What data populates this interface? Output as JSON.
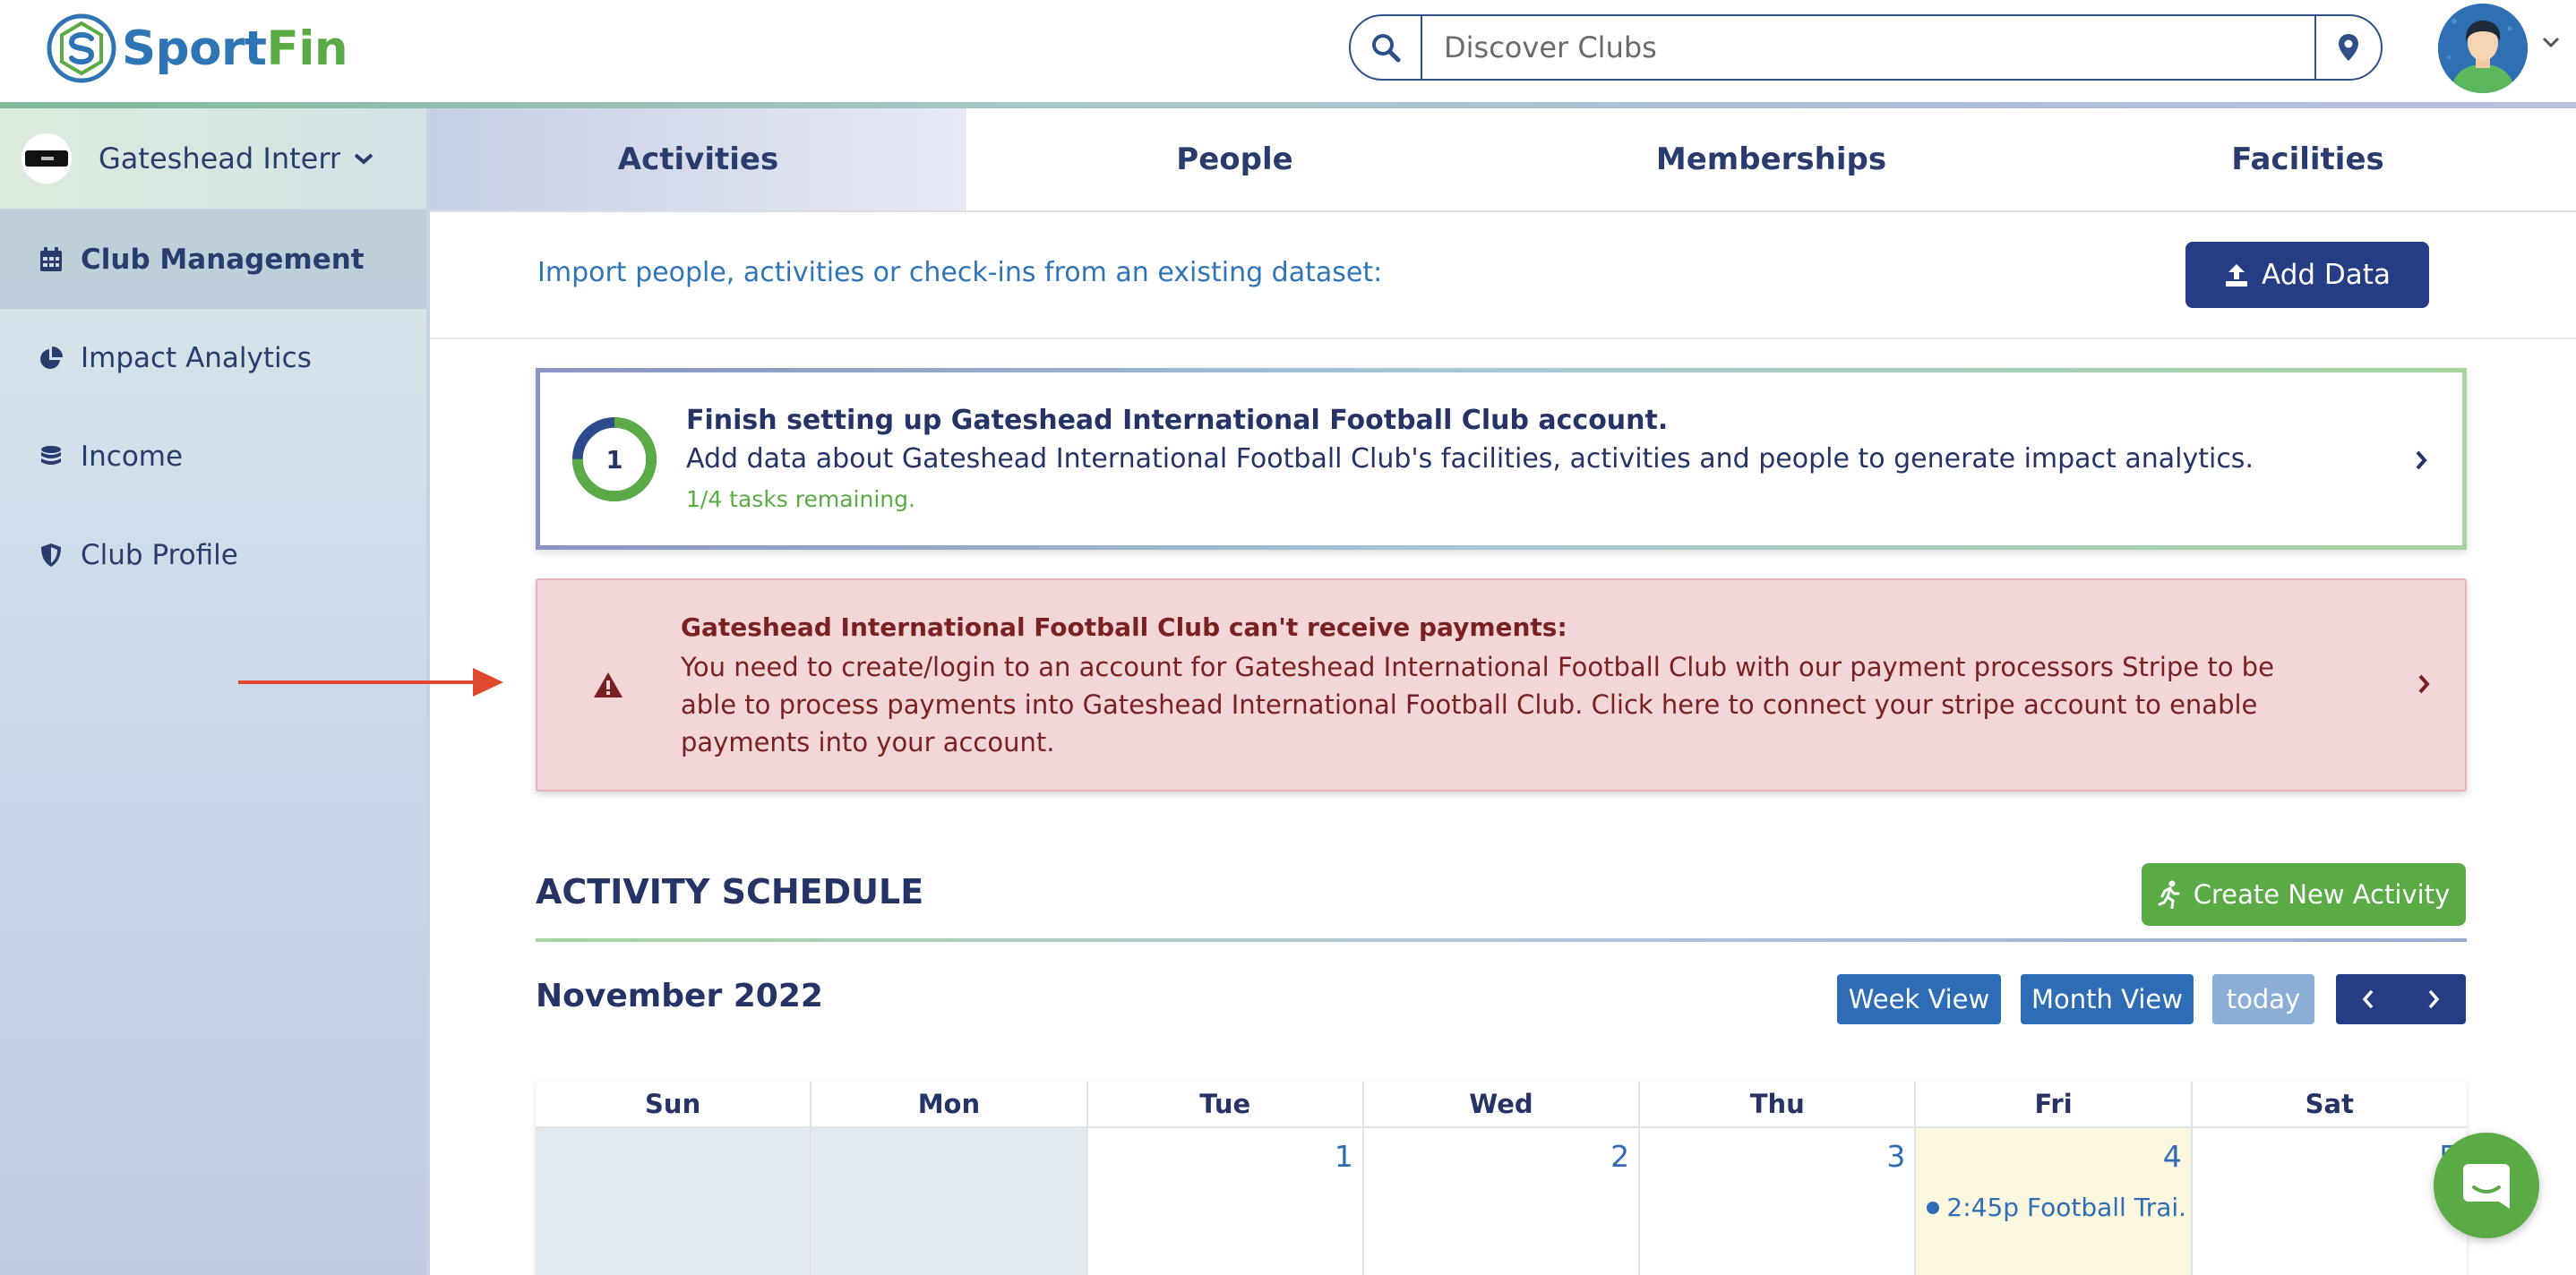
{
  "app": {
    "logo_sport": "Sport",
    "logo_fin": "Fin"
  },
  "search": {
    "placeholder": "Discover Clubs",
    "value": ""
  },
  "sidebar": {
    "club_name": "Gateshead Intern...",
    "items": [
      {
        "label": "Club Management",
        "icon": "calendar-icon",
        "active": true
      },
      {
        "label": "Impact Analytics",
        "icon": "pie-chart-icon",
        "active": false
      },
      {
        "label": "Income",
        "icon": "coins-icon",
        "active": false
      },
      {
        "label": "Club Profile",
        "icon": "shield-icon",
        "active": false
      }
    ]
  },
  "tabs": [
    {
      "label": "Activities",
      "active": true
    },
    {
      "label": "People",
      "active": false
    },
    {
      "label": "Memberships",
      "active": false
    },
    {
      "label": "Facilities",
      "active": false
    }
  ],
  "import_bar": {
    "text": "Import people, activities or check-ins from an existing dataset:",
    "button_label": "Add Data"
  },
  "setup": {
    "step": "1",
    "progress": 0.75,
    "title": "Finish setting up Gateshead International Football Club account.",
    "description": "Add data about Gateshead International Football Club's facilities, activities and people to generate impact analytics.",
    "tasks": "1/4 tasks remaining."
  },
  "payment_alert": {
    "title": "Gateshead International Football Club can't receive payments:",
    "body": "You need to create/login to an account for Gateshead International Football Club with our payment processors Stripe to be able to process payments into Gateshead International Football Club. Click here to connect your stripe account to enable payments into your account."
  },
  "schedule": {
    "title": "ACTIVITY SCHEDULE",
    "create_label": "Create New Activity",
    "month": "November 2022",
    "week_view": "Week View",
    "month_view": "Month View",
    "today": "today",
    "days": [
      "Sun",
      "Mon",
      "Tue",
      "Wed",
      "Thu",
      "Fri",
      "Sat"
    ],
    "first_row": [
      "",
      "",
      "1",
      "2",
      "3",
      "4",
      "5"
    ],
    "event": {
      "time": "2:45p",
      "title": "Football Trai..."
    }
  },
  "colors": {
    "brand_blue": "#2f75b5",
    "brand_green": "#5aab45",
    "navy": "#253d85",
    "alert_bg": "#f2d6d8",
    "alert_text": "#7a1f22"
  }
}
